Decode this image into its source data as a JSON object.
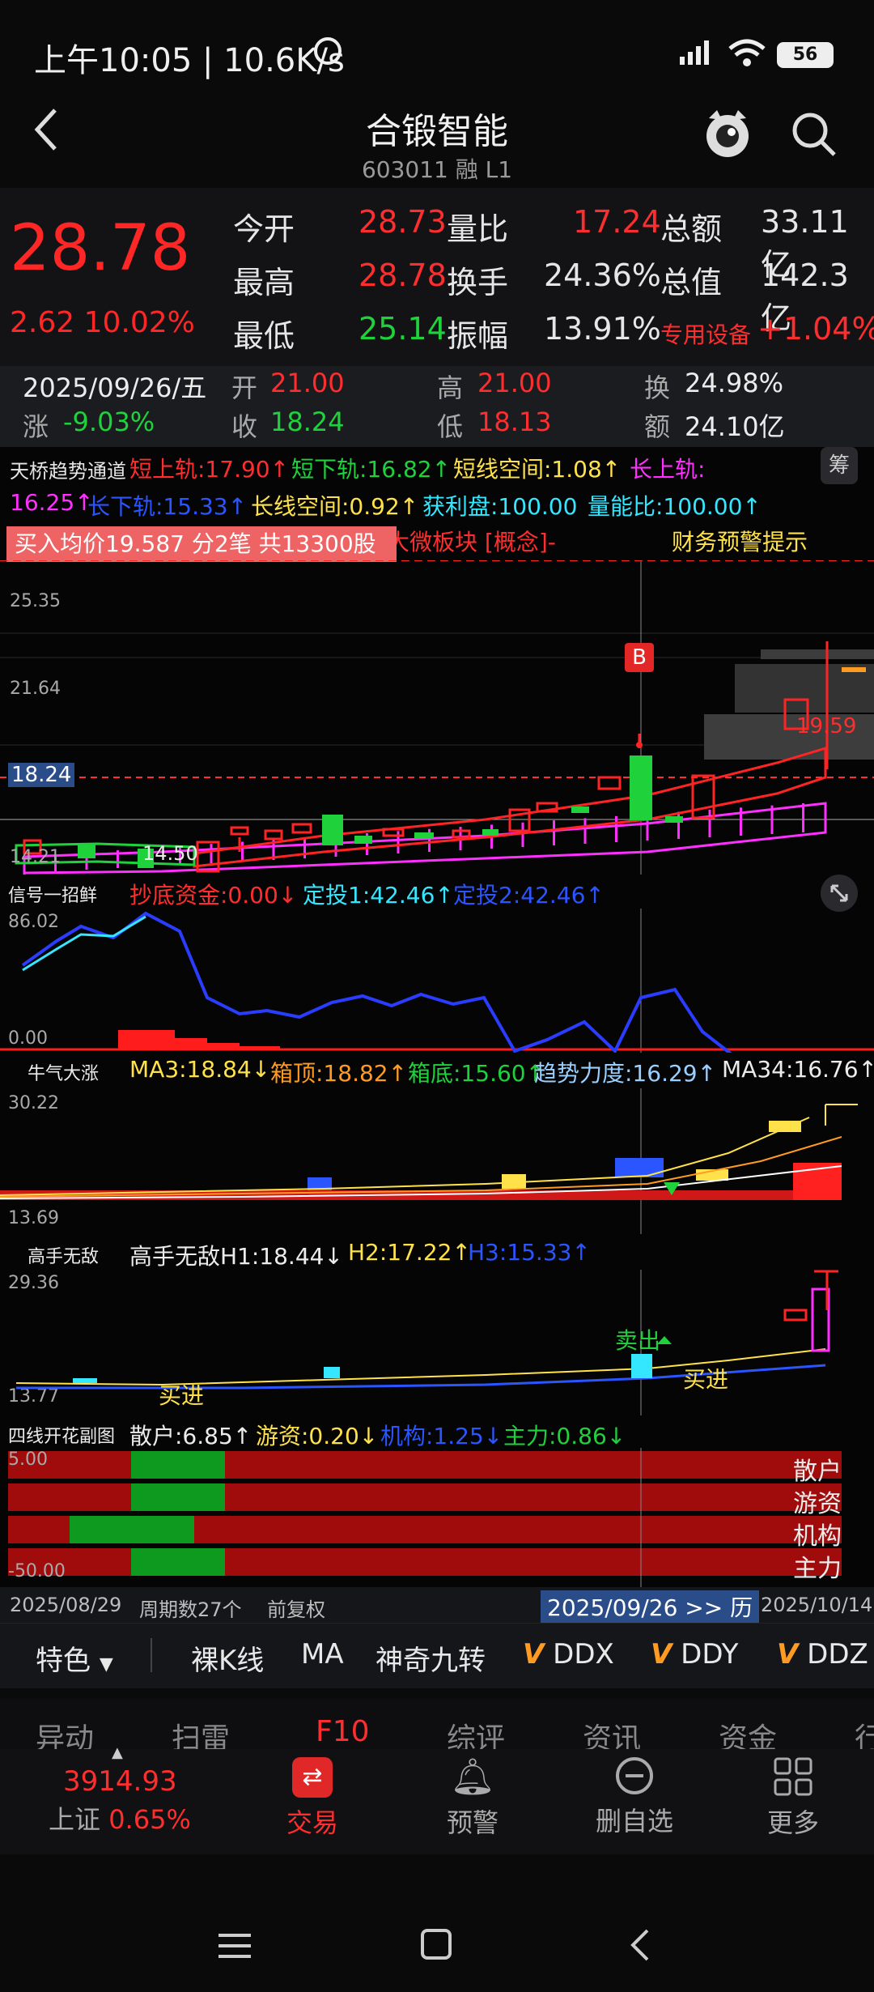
{
  "status_bar": {
    "time": "上午10:05 | 10.6K/s",
    "battery": "56"
  },
  "header": {
    "title": "合锻智能",
    "code": "603011 融 L1"
  },
  "quote": {
    "price": "28.78",
    "change": "2.62",
    "change_pct": "10.02%",
    "rows": [
      {
        "l1": "今开",
        "v1": "28.73",
        "l2": "量比",
        "v2": "17.24",
        "l3": "总额",
        "v3": "33.11亿"
      },
      {
        "l1": "最高",
        "v1": "28.78",
        "l2": "换手",
        "v2": "24.36%",
        "l3": "总值",
        "v3": "142.3亿"
      },
      {
        "l1": "最低",
        "v1": "25.14",
        "l2": "振幅",
        "v2": "13.91%",
        "l3": "专用设备",
        "v3": "+1.04%"
      }
    ]
  },
  "history": {
    "date": "2025/09/26/五",
    "open_label": "开",
    "open": "21.00",
    "high_label": "高",
    "high": "21.00",
    "turnover_label": "换",
    "turnover": "24.98%",
    "chg_label": "涨",
    "chg": "-9.03%",
    "close_label": "收",
    "close": "18.24",
    "low_label": "低",
    "low": "18.13",
    "amount_label": "额",
    "amount": "24.10亿"
  },
  "main_chart": {
    "indicator": "天桥趋势通道",
    "p1": "短上轨:17.90↑",
    "p2": "短下轨:16.82↑",
    "p3": "短线空间:1.08↑",
    "p4": "长上轨:",
    "p5": "16.25↑",
    "p6": "长下轨:15.33↑",
    "p7": "长线空间:0.92↑",
    "p8": "获利盘:100.00",
    "p9": "量能比:100.00↑",
    "tooltip": "买入均价19.587 分2笔 共13300股",
    "behind1": "大微板块 [概念]-",
    "behind2": "财务预警提示",
    "y_labels": [
      "25.35",
      "21.64",
      "18.24",
      "14.21"
    ],
    "low_mark": "14.50",
    "right_mark": "19.59",
    "b_badge": "B",
    "filter_icon_label": "筹"
  },
  "sub1": {
    "name": "信号一招鲜",
    "a": "抄底资金:0.00↓",
    "b": "定投1:42.46↑",
    "c": "定投2:42.46↑",
    "ymax": "86.02",
    "ymin": "0.00"
  },
  "sub2": {
    "name": "牛气大涨",
    "a": "MA3:18.84↓",
    "b": "箱顶:18.82↑",
    "c": "箱底:15.60↑",
    "d": "趋势力度:16.29↑",
    "e": "MA34:16.76↑",
    "ymax": "30.22",
    "ymin": "13.69"
  },
  "sub3": {
    "name": "高手无敌",
    "a": "高手无敌H1:18.44↓",
    "b": "H2:17.22↑",
    "c": "H3:15.33↑",
    "ymax": "29.36",
    "ymin": "13.77",
    "buy1": "买进",
    "sell": "卖出",
    "buy2": "买进"
  },
  "sub4": {
    "name": "四线开花副图",
    "a": "散户:6.85↑",
    "b": "游资:0.20↓",
    "c": "机构:1.25↓",
    "d": "主力:0.86↓",
    "ymax": "5.00",
    "ymin": "-50.00",
    "rows": [
      "散户",
      "游资",
      "机构",
      "主力"
    ]
  },
  "period": {
    "start": "2025/08/29",
    "count": "周期数27个",
    "adj": "前复权",
    "cursor": "2025/09/26 >> 历",
    "end": "2025/10/14"
  },
  "tools": [
    "特色",
    "裸K线",
    "MA",
    "神奇九转",
    "DDX",
    "DDY",
    "DDZ"
  ],
  "tabs": [
    "异动",
    "扫雷",
    "F10",
    "综评",
    "资讯",
    "资金",
    "行"
  ],
  "bottom_nav": {
    "index_value": "3914.93",
    "index_name": "上证",
    "index_pct": "0.65%",
    "trade": "交易",
    "alert": "预警",
    "remove": "删自选",
    "more": "更多"
  },
  "colors": {
    "up": "#ff2e2e",
    "down": "#1fd23c",
    "panel": "#131316"
  }
}
